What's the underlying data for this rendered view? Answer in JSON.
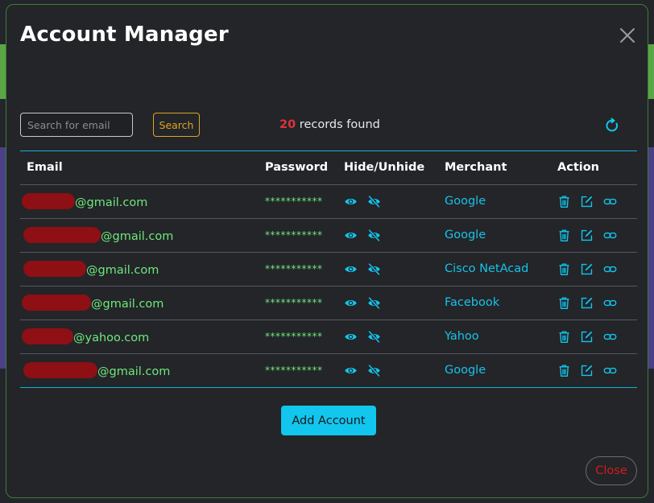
{
  "modal": {
    "title": "Account Manager"
  },
  "search": {
    "placeholder": "Search for email",
    "button_label": "Search"
  },
  "records": {
    "count": "20",
    "suffix": " records found"
  },
  "table": {
    "headers": [
      "Email",
      "Password",
      "Hide/Unhide",
      "Merchant",
      "Action"
    ],
    "rows": [
      {
        "email_suffix": "@gmail.com",
        "password": "***********",
        "merchant": "Google"
      },
      {
        "email_suffix": "@gmail.com",
        "password": "***********",
        "merchant": "Google"
      },
      {
        "email_suffix": "@gmail.com",
        "password": "***********",
        "merchant": "Cisco NetAcad"
      },
      {
        "email_suffix": "@gmail.com",
        "password": "***********",
        "merchant": "Facebook"
      },
      {
        "email_suffix": "@yahoo.com",
        "password": "***********",
        "merchant": "Yahoo"
      },
      {
        "email_suffix": "@gmail.com",
        "password": "***********",
        "merchant": "Google"
      }
    ]
  },
  "actions": {
    "add_label": "Add Account",
    "close_label": "Close"
  },
  "icons": {
    "close": "close-icon",
    "refresh": "refresh-icon",
    "show": "eye-icon",
    "hide": "eye-slash-icon",
    "delete": "trash-icon",
    "edit": "edit-icon",
    "link": "link-icon"
  },
  "colors": {
    "accent": "#12c6ee",
    "email_text": "#6fe87a",
    "count": "#e0323a",
    "search_button": "#e0a51e",
    "close_text": "#d41a1a"
  }
}
